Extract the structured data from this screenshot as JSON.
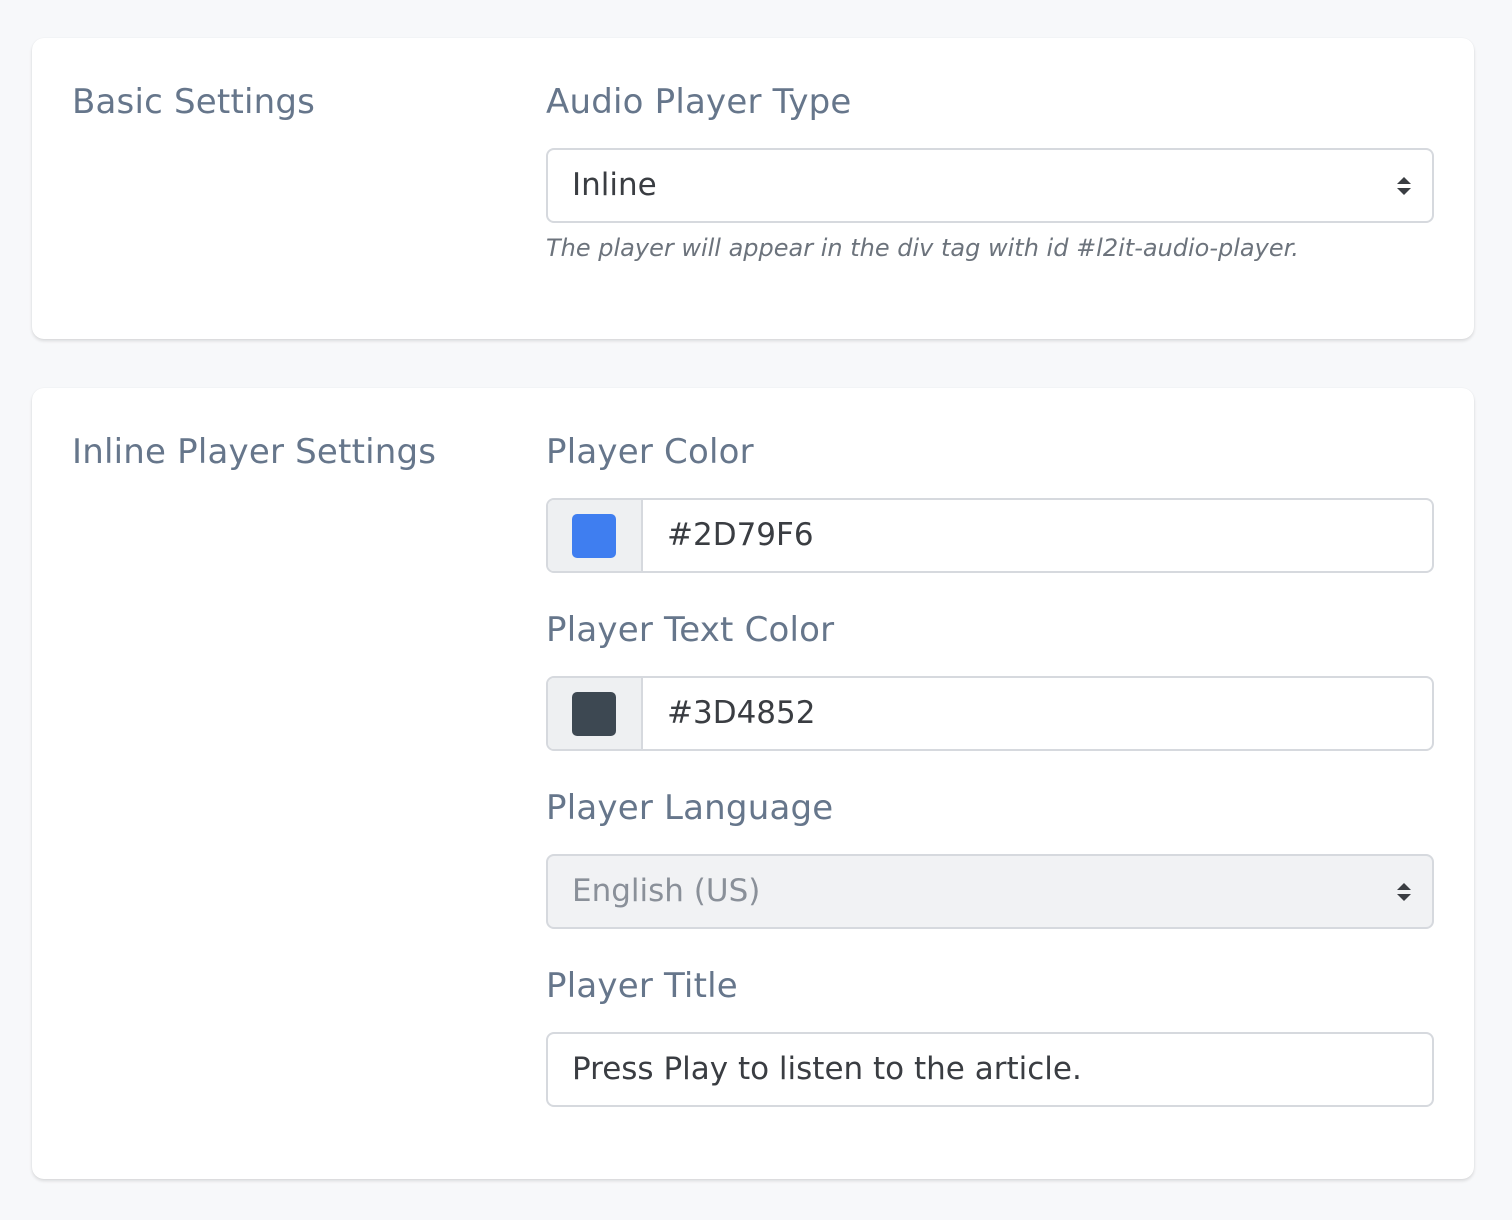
{
  "basic_settings": {
    "section_title": "Basic Settings",
    "audio_player_type": {
      "label": "Audio Player Type",
      "selected": "Inline",
      "help": "The player will appear in the div tag with id #l2it-audio-player."
    }
  },
  "inline_player_settings": {
    "section_title": "Inline Player Settings",
    "player_color": {
      "label": "Player Color",
      "value": "#2D79F6",
      "swatch_color": "#3f7ef0"
    },
    "player_text_color": {
      "label": "Player Text Color",
      "value": "#3D4852",
      "swatch_color": "#3d4852"
    },
    "player_language": {
      "label": "Player Language",
      "selected": "English (US)",
      "disabled": true
    },
    "player_title": {
      "label": "Player Title",
      "value": "Press Play to listen to the article."
    }
  },
  "icons": {
    "select_caret": "sort-caret-icon"
  },
  "colors": {
    "label": "#66768b",
    "input_border": "#d6d9de",
    "card_bg": "#ffffff",
    "page_bg": "#f7f8fa"
  }
}
